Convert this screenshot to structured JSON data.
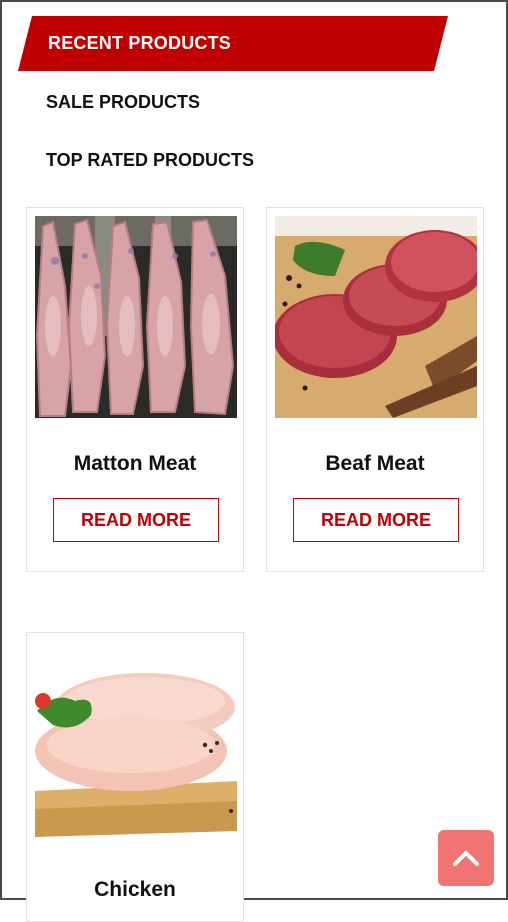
{
  "tabs": {
    "recent": "RECENT PRODUCTS",
    "sale": "SALE PRODUCTS",
    "top_rated": "TOP RATED PRODUCTS"
  },
  "products": [
    {
      "name": "Matton Meat",
      "button": "READ MORE",
      "image": "lamb-carcass-photo"
    },
    {
      "name": "Beaf Meat",
      "button": "READ MORE",
      "image": "beef-steak-photo"
    },
    {
      "name": "Chicken",
      "image": "chicken-breast-photo"
    }
  ],
  "colors": {
    "accent": "#c00000",
    "scroll_button": "#f07472"
  },
  "icons": {
    "scroll_top": "chevron-up-icon"
  }
}
